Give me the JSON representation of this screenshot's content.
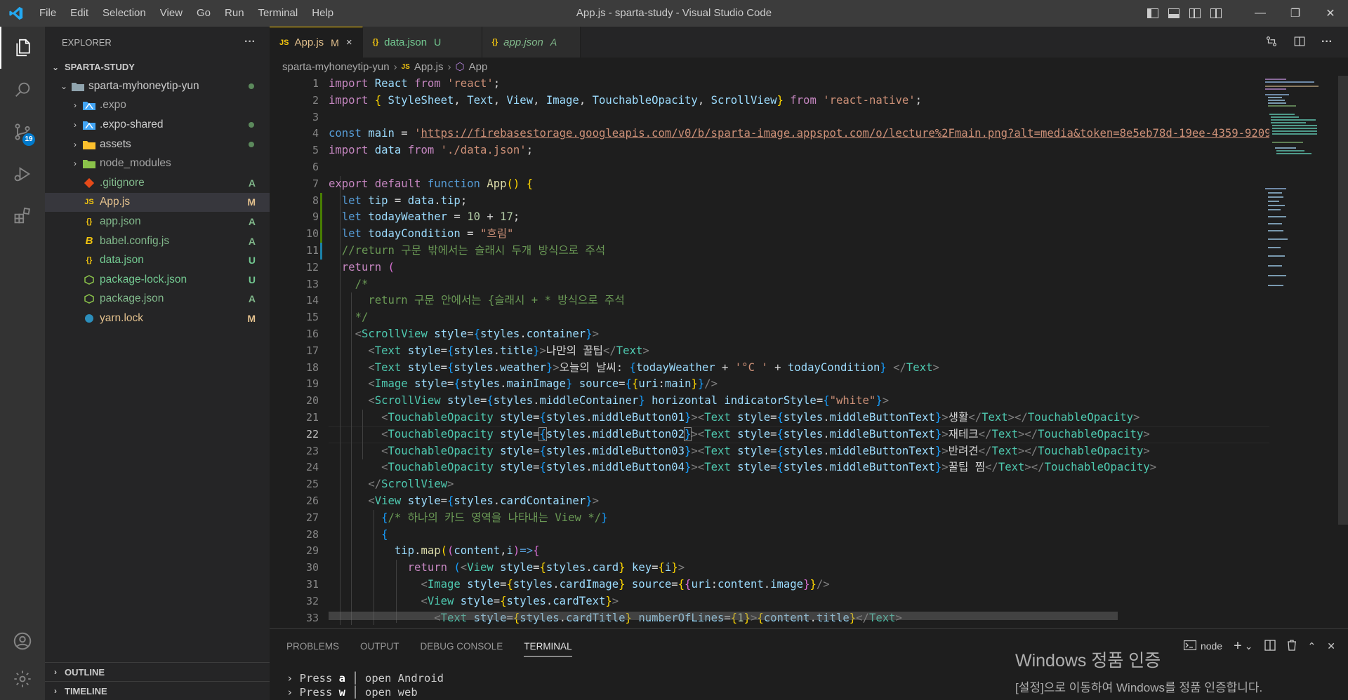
{
  "window": {
    "title": "App.js - sparta-study - Visual Studio Code"
  },
  "menu": [
    "File",
    "Edit",
    "Selection",
    "View",
    "Go",
    "Run",
    "Terminal",
    "Help"
  ],
  "activity": {
    "scm_badge": "19"
  },
  "explorer": {
    "header": "EXPLORER",
    "more": "···",
    "workspace": "SPARTA-STUDY",
    "folder": "sparta-myhoneytip-yun",
    "items": [
      {
        "label": ".expo",
        "status": ""
      },
      {
        "label": ".expo-shared",
        "status": ""
      },
      {
        "label": "assets",
        "status": ""
      },
      {
        "label": "node_modules",
        "status": ""
      },
      {
        "label": ".gitignore",
        "status": "A"
      },
      {
        "label": "App.js",
        "status": "M"
      },
      {
        "label": "app.json",
        "status": "A"
      },
      {
        "label": "babel.config.js",
        "status": "A"
      },
      {
        "label": "data.json",
        "status": "U"
      },
      {
        "label": "package-lock.json",
        "status": "U"
      },
      {
        "label": "package.json",
        "status": "A"
      },
      {
        "label": "yarn.lock",
        "status": "M"
      }
    ],
    "outline": "OUTLINE",
    "timeline": "TIMELINE"
  },
  "tabs": [
    {
      "label": "App.js",
      "status": "M",
      "close": "×"
    },
    {
      "label": "data.json",
      "status": "U"
    },
    {
      "label": "app.json",
      "status": "A"
    }
  ],
  "breadcrumb": [
    "sparta-myhoneytip-yun",
    "App.js",
    "App"
  ],
  "editor": {
    "line_numbers": [
      "1",
      "2",
      "3",
      "4",
      "5",
      "6",
      "7",
      "8",
      "9",
      "10",
      "11",
      "12",
      "13",
      "14",
      "15",
      "16",
      "17",
      "18",
      "19",
      "20",
      "21",
      "22",
      "23",
      "24",
      "25",
      "26",
      "27",
      "28",
      "29",
      "30",
      "31",
      "32",
      "33"
    ],
    "current_line": "22"
  },
  "panel": {
    "tabs": [
      "PROBLEMS",
      "OUTPUT",
      "DEBUG CONSOLE",
      "TERMINAL"
    ],
    "terminal_name": "node",
    "terminal_lines": [
      {
        "prefix": "› Press ",
        "key": "a",
        "sep": " │ ",
        "text": "open Android"
      },
      {
        "prefix": "› Press ",
        "key": "w",
        "sep": " │ ",
        "text": "open web"
      }
    ]
  },
  "windows_activation": {
    "title": "Windows 정품 인증",
    "message": "[설정]으로 이동하여 Windows를 정품 인증합니다."
  },
  "colors": {
    "accent": "#007acc",
    "modified": "#e2c08d",
    "added": "#81b88b",
    "untracked": "#73c991"
  }
}
